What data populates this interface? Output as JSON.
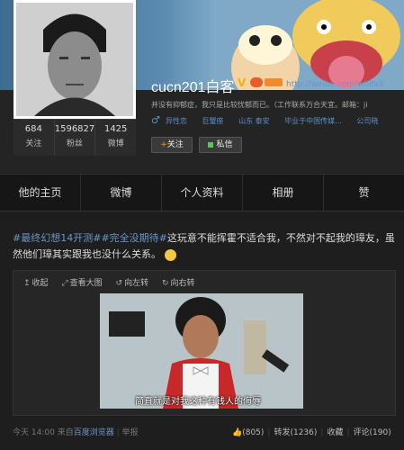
{
  "profile": {
    "name": "cucn201白客",
    "url": "http://weibo.com/whitek",
    "bio": "并没有抑郁症，我只是比较忧郁而已。（工作联系万合天宜。邮箱：ji",
    "gender_icon": "♂",
    "tags": [
      "异性恋",
      "巨蟹座",
      "山东 泰安",
      "毕业于中国传媒...",
      "公司晓"
    ],
    "stats": [
      {
        "value": "684",
        "label": "关注"
      },
      {
        "value": "1596827",
        "label": "粉丝"
      },
      {
        "value": "1425",
        "label": "微博"
      }
    ],
    "follow_label": "关注",
    "follow_plus": "+",
    "message_label": "私信",
    "verified_mark": "V"
  },
  "nav": {
    "tabs": [
      "他的主页",
      "微博",
      "个人资料",
      "相册",
      "赞"
    ]
  },
  "post": {
    "topic1": "#最终幻想14开测#",
    "topic2": "#完全没期待#",
    "text": "这玩意不能挥霍不适合我，不然对不起我的璋友，虽然他们璋其实跟我也没什么关系。",
    "toolbar": {
      "collapse": "收起",
      "view_large": "查看大图",
      "rotate_left": "向左转",
      "rotate_right": "向右转"
    },
    "caption": "简直就是对我这种有钱人的侮辱",
    "time": "今天 14:00",
    "source_prefix": "来自",
    "source": "百度浏览器",
    "report": "举报",
    "likes": "(805)",
    "repost": "转发(1236)",
    "favorite": "收藏",
    "comment": "评论(190)"
  },
  "colors": {
    "background": "#1d1d1d",
    "link": "#6a96c8",
    "accent_orange": "#f29a1d"
  }
}
